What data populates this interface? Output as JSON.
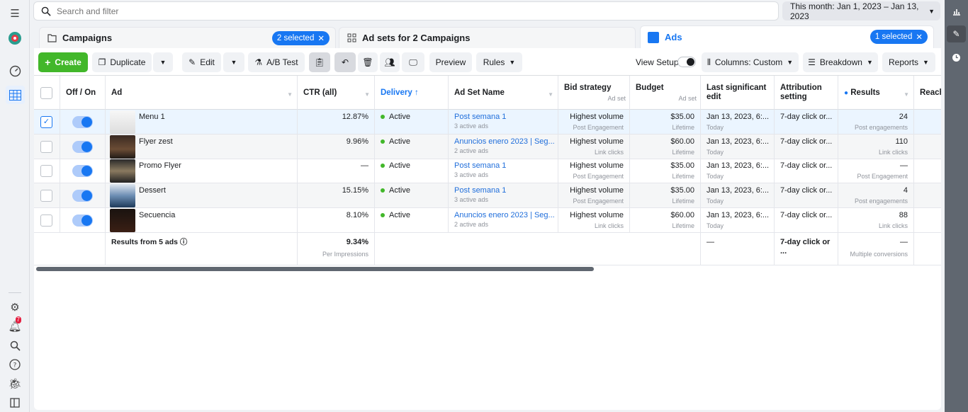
{
  "search": {
    "placeholder": "Search and filter"
  },
  "date_range": "This month: Jan 1, 2023 – Jan 13, 2023",
  "tabs": [
    {
      "label": "Campaigns",
      "pill": "2 selected"
    },
    {
      "label": "Ad sets for 2 Campaigns",
      "pill": ""
    },
    {
      "label": "Ads",
      "pill": "1 selected"
    }
  ],
  "toolbar": {
    "create": "Create",
    "duplicate": "Duplicate",
    "edit": "Edit",
    "ab_test": "A/B Test",
    "preview": "Preview",
    "rules": "Rules",
    "view_setup": "View Setup",
    "columns": "Columns: Custom",
    "breakdown": "Breakdown",
    "reports": "Reports"
  },
  "left_rail": {
    "notification_count": "7"
  },
  "columns": [
    "Off / On",
    "Ad",
    "CTR (all)",
    "Delivery",
    "Ad Set Name",
    "Bid strategy",
    "Ad set",
    "Budget",
    "Ad set",
    "Last significant edit",
    "Attribution setting",
    "Results",
    "Reach"
  ],
  "rows": [
    {
      "ad": "Menu 1",
      "ctr": "12.87%",
      "delivery": "Active",
      "adset": "Post semana 1",
      "adset_sub": "3 active ads",
      "bid": "Highest volume",
      "bid_sub": "Post Engagement",
      "budget": "$35.00",
      "budget_sub": "Lifetime",
      "edit": "Jan 13, 2023, 6:...",
      "edit_sub": "Today",
      "attr": "7-day click or...",
      "results": "24",
      "results_sub": "Post engagements",
      "selected": true
    },
    {
      "ad": "Flyer zest",
      "ctr": "9.96%",
      "delivery": "Active",
      "adset": "Anuncios enero 2023 | Seg...",
      "adset_sub": "2 active ads",
      "bid": "Highest volume",
      "bid_sub": "Link clicks",
      "budget": "$60.00",
      "budget_sub": "Lifetime",
      "edit": "Jan 13, 2023, 6:...",
      "edit_sub": "Today",
      "attr": "7-day click or...",
      "results": "110",
      "results_sub": "Link clicks",
      "selected": false
    },
    {
      "ad": "Promo Flyer",
      "ctr": "—",
      "delivery": "Active",
      "adset": "Post semana 1",
      "adset_sub": "3 active ads",
      "bid": "Highest volume",
      "bid_sub": "Post Engagement",
      "budget": "$35.00",
      "budget_sub": "Lifetime",
      "edit": "Jan 13, 2023, 6:...",
      "edit_sub": "Today",
      "attr": "7-day click or...",
      "results": "—",
      "results_sub": "Post Engagement",
      "selected": false
    },
    {
      "ad": "Dessert",
      "ctr": "15.15%",
      "delivery": "Active",
      "adset": "Post semana 1",
      "adset_sub": "3 active ads",
      "bid": "Highest volume",
      "bid_sub": "Post Engagement",
      "budget": "$35.00",
      "budget_sub": "Lifetime",
      "edit": "Jan 13, 2023, 6:...",
      "edit_sub": "Today",
      "attr": "7-day click or...",
      "results": "4",
      "results_sub": "Post engagements",
      "selected": false
    },
    {
      "ad": "Secuencia",
      "ctr": "8.10%",
      "delivery": "Active",
      "adset": "Anuncios enero 2023 | Seg...",
      "adset_sub": "2 active ads",
      "bid": "Highest volume",
      "bid_sub": "Link clicks",
      "budget": "$60.00",
      "budget_sub": "Lifetime",
      "edit": "Jan 13, 2023, 6:...",
      "edit_sub": "Today",
      "attr": "7-day click or...",
      "results": "88",
      "results_sub": "Link clicks",
      "selected": false
    }
  ],
  "summary": {
    "label": "Results from 5 ads",
    "ctr": "9.34%",
    "ctr_sub": "Per Impressions",
    "edit": "—",
    "attr": "7-day click or ...",
    "results": "—",
    "results_sub": "Multiple conversions"
  },
  "colors": {
    "accent": "#1877f2",
    "create": "#42b72a",
    "active_dot": "#42b72a"
  }
}
